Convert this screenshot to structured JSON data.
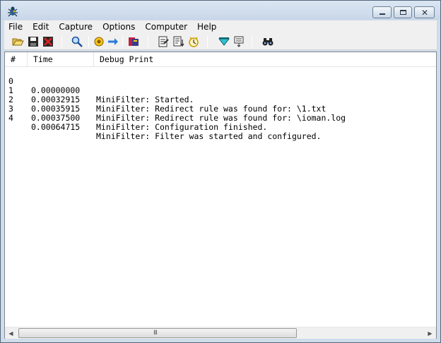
{
  "menu": {
    "items": [
      {
        "label": "File"
      },
      {
        "label": "Edit"
      },
      {
        "label": "Capture"
      },
      {
        "label": "Options"
      },
      {
        "label": "Computer"
      },
      {
        "label": "Help"
      }
    ]
  },
  "toolbar": {
    "icons": [
      "open-icon",
      "save-icon",
      "clear-icon",
      "find-icon",
      "capture-icon",
      "autoscroll-icon",
      "filter-icon",
      "log-icon",
      "copy-icon",
      "timestamp-icon",
      "highlight-icon",
      "options-icon",
      "binoculars-icon"
    ]
  },
  "table": {
    "columns": {
      "num": "#",
      "time": "Time",
      "debug": "Debug Print"
    },
    "rows": [
      {
        "num": "0",
        "time": "0.00000000",
        "msg": "MiniFilter: Started."
      },
      {
        "num": "1",
        "time": "0.00032915",
        "msg": "MiniFilter: Redirect rule was found for: \\1.txt"
      },
      {
        "num": "2",
        "time": "0.00035915",
        "msg": "MiniFilter: Redirect rule was found for: \\ioman.log"
      },
      {
        "num": "3",
        "time": "0.00037500",
        "msg": "MiniFilter: Configuration finished."
      },
      {
        "num": "4",
        "time": "0.00064715",
        "msg": "MiniFilter: Filter was started and configured."
      }
    ]
  },
  "scrollbar": {
    "grip": "III"
  }
}
